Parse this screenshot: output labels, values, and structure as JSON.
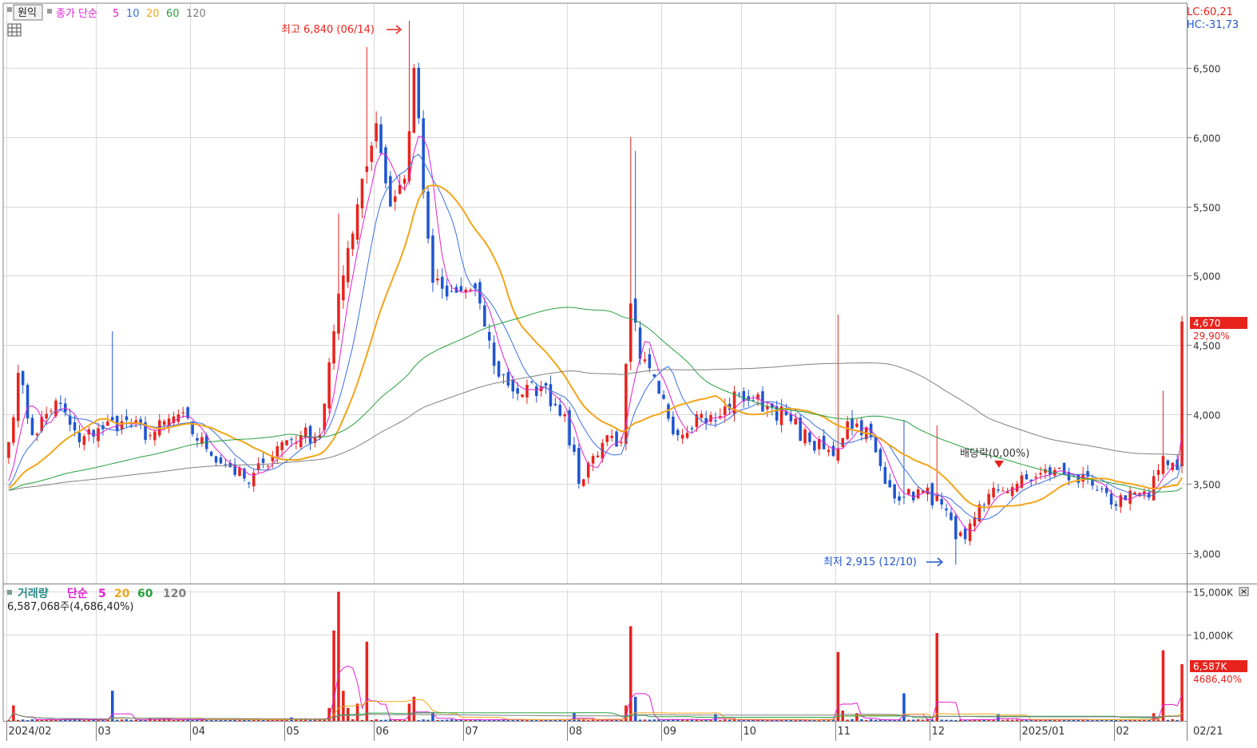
{
  "header": {
    "won_button": "원익",
    "price_ma_label": "종가 단순",
    "ma_periods": [
      "5",
      "10",
      "20",
      "60",
      "120"
    ],
    "ma_colors": [
      "#e020d0",
      "#3a6fe0",
      "#f2a51a",
      "#28a040",
      "#808080"
    ],
    "lc_label": "LC:60,21",
    "hc_label": "HC:-31,73"
  },
  "annotations": {
    "high_label": "최고 6,840 (06/14)",
    "low_label": "최저 2,915 (12/10)",
    "dividend_label": "배당락(0,00%)"
  },
  "last_price": {
    "value": "4,670",
    "change": "29,90%"
  },
  "volume_panel": {
    "title": "거래량",
    "ma_label": "단순",
    "ma_periods": [
      "5",
      "20",
      "60",
      "120"
    ],
    "current_label": "6,587,068주(4,686,40%)",
    "last_volume_badge": "6,587K",
    "last_volume_pct": "4686,40%"
  },
  "x_axis_last_label": "02/21",
  "colors": {
    "up": "#e8231d",
    "down": "#1f55d0",
    "grid": "#d9d9d9",
    "badge": "#e8231d"
  },
  "chart_data": [
    {
      "type": "candlestick",
      "title": "",
      "y_ticks": [
        3000,
        3500,
        4000,
        4500,
        5000,
        5500,
        6000,
        6500
      ],
      "y_tick_labels": [
        "3,000",
        "3,500",
        "4,000",
        "4,500",
        "5,000",
        "5,500",
        "6,000",
        "6,500"
      ],
      "ylim": [
        2780,
        6960
      ],
      "x_tick_labels": [
        "2024/02",
        "03",
        "04",
        "05",
        "06",
        "07",
        "08",
        "09",
        "10",
        "11",
        "12",
        "2025/01",
        "02"
      ],
      "x_tick_positions": [
        0,
        19,
        39,
        59,
        78,
        97,
        119,
        139,
        156,
        176,
        196,
        215,
        235
      ],
      "num_sessions": 250,
      "anchors": [
        [
          0,
          3800
        ],
        [
          2,
          4300
        ],
        [
          5,
          3850
        ],
        [
          10,
          4100
        ],
        [
          15,
          3800
        ],
        [
          19,
          3900
        ],
        [
          24,
          3950
        ],
        [
          30,
          3850
        ],
        [
          36,
          4000
        ],
        [
          42,
          3750
        ],
        [
          47,
          3620
        ],
        [
          51,
          3500
        ],
        [
          54,
          3650
        ],
        [
          58,
          3800
        ],
        [
          62,
          3850
        ],
        [
          66,
          3850
        ],
        [
          69,
          4600
        ],
        [
          72,
          5200
        ],
        [
          75,
          5700
        ],
        [
          78,
          6100
        ],
        [
          81,
          5500
        ],
        [
          84,
          5700
        ],
        [
          86,
          6500
        ],
        [
          88,
          5600
        ],
        [
          90,
          4950
        ],
        [
          93,
          4850
        ],
        [
          97,
          4900
        ],
        [
          100,
          4800
        ],
        [
          103,
          4350
        ],
        [
          108,
          4150
        ],
        [
          113,
          4200
        ],
        [
          118,
          4000
        ],
        [
          121,
          3500
        ],
        [
          124,
          3700
        ],
        [
          127,
          3850
        ],
        [
          130,
          3800
        ],
        [
          132,
          4800
        ],
        [
          134,
          4400
        ],
        [
          138,
          4150
        ],
        [
          142,
          3850
        ],
        [
          146,
          4000
        ],
        [
          150,
          3950
        ],
        [
          155,
          4150
        ],
        [
          158,
          4100
        ],
        [
          162,
          4050
        ],
        [
          166,
          3950
        ],
        [
          170,
          3800
        ],
        [
          175,
          3700
        ],
        [
          178,
          3950
        ],
        [
          182,
          3900
        ],
        [
          186,
          3500
        ],
        [
          190,
          3400
        ],
        [
          194,
          3450
        ],
        [
          198,
          3350
        ],
        [
          201,
          3100
        ],
        [
          203,
          3100
        ],
        [
          206,
          3350
        ],
        [
          210,
          3450
        ],
        [
          214,
          3500
        ],
        [
          218,
          3550
        ],
        [
          222,
          3600
        ],
        [
          226,
          3550
        ],
        [
          231,
          3450
        ],
        [
          234,
          3350
        ],
        [
          238,
          3450
        ],
        [
          242,
          3400
        ],
        [
          245,
          3700
        ],
        [
          247,
          3650
        ],
        [
          248,
          3600
        ],
        [
          249,
          4670
        ]
      ],
      "wick_spikes": [
        [
          22,
          4600
        ],
        [
          70,
          5450
        ],
        [
          76,
          6650
        ],
        [
          85,
          6840
        ],
        [
          132,
          6000
        ],
        [
          133,
          5900
        ],
        [
          176,
          4720
        ],
        [
          190,
          3960
        ],
        [
          197,
          3920
        ],
        [
          201,
          2915
        ],
        [
          245,
          4170
        ]
      ],
      "ma_periods": [
        5,
        10,
        20,
        60,
        120
      ],
      "high_annotation": {
        "index": 86,
        "price": 6840
      },
      "low_annotation": {
        "index": 202,
        "price": 2915
      },
      "dividend_marker_index": 215
    },
    {
      "type": "bar",
      "title": "",
      "y_ticks": [
        10000,
        15000
      ],
      "y_tick_labels": [
        "10,000K",
        "15,000K"
      ],
      "ylim": [
        0,
        15300
      ],
      "unit": "K",
      "num_sessions": 250,
      "base_volume_k": 140,
      "spikes": [
        [
          1,
          1800
        ],
        [
          22,
          3500
        ],
        [
          30,
          300
        ],
        [
          60,
          400
        ],
        [
          68,
          1500
        ],
        [
          69,
          10500
        ],
        [
          70,
          15000
        ],
        [
          71,
          3500
        ],
        [
          72,
          1500
        ],
        [
          74,
          2000
        ],
        [
          76,
          9200
        ],
        [
          85,
          2000
        ],
        [
          86,
          2800
        ],
        [
          90,
          1000
        ],
        [
          120,
          900
        ],
        [
          131,
          1800
        ],
        [
          132,
          11000
        ],
        [
          133,
          2800
        ],
        [
          150,
          800
        ],
        [
          176,
          8000
        ],
        [
          177,
          1200
        ],
        [
          180,
          900
        ],
        [
          190,
          3200
        ],
        [
          197,
          10200
        ],
        [
          210,
          800
        ],
        [
          243,
          900
        ],
        [
          245,
          8200
        ],
        [
          249,
          6587
        ]
      ],
      "volume_ma_periods": [
        5,
        20,
        60,
        120
      ],
      "last_volume_k": 6587
    }
  ]
}
